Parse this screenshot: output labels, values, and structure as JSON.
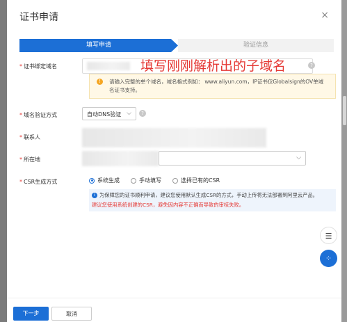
{
  "dialog": {
    "title": "证书申请",
    "close": "×"
  },
  "steps": [
    {
      "label": "填写申请",
      "active": true
    },
    {
      "label": "验证信息",
      "active": false
    }
  ],
  "form": {
    "domain": {
      "label": "证书绑定域名",
      "required": "*",
      "help": "?",
      "annotation": "填写刚刚解析出的子域名",
      "notice_line1": "请输入完整的单个域名，域名格式例如： www.aliyun.com，IP证书仅Globalsign的OV单域",
      "notice_line2": "名证书支持。"
    },
    "verify_method": {
      "label": "域名验证方式",
      "required": "*",
      "value": "自动DNS验证",
      "help": "?"
    },
    "contact": {
      "label": "联系人",
      "required": "*"
    },
    "location": {
      "label": "所在地",
      "required": "*"
    },
    "csr": {
      "label": "CSR生成方式",
      "required": "*",
      "options": [
        {
          "label": "系统生成",
          "checked": true
        },
        {
          "label": "手动填写",
          "checked": false
        },
        {
          "label": "选择已有的CSR",
          "checked": false
        }
      ],
      "info_line1": "为保障您的证书顺利申请，建议您使用默认生成CSR的方式，手动上传将无法部署到阿里云产品。",
      "info_line2": "建议您使用系统创建的CSR，避免因内容不正确而导致的审核失败。"
    }
  },
  "footer": {
    "next_label": "下一步",
    "cancel_label": "取消"
  },
  "colors": {
    "primary": "#1c6fd6",
    "annotation": "#e53935",
    "notice_bg": "#fff8e6",
    "info_bg": "#eef4fc"
  },
  "icons": {
    "chat": "chat-icon",
    "apps": "apps-icon"
  }
}
